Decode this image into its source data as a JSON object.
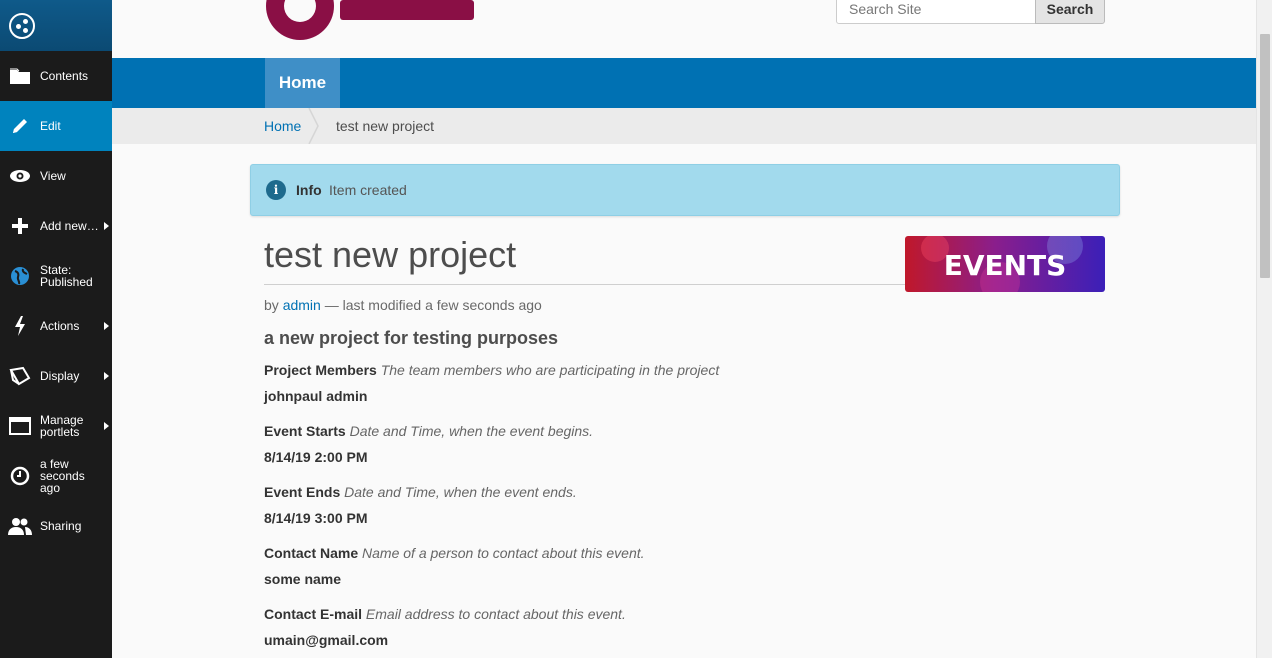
{
  "toolbar": {
    "items": [
      {
        "label": "Contents",
        "icon": "folder-icon"
      },
      {
        "label": "Edit",
        "icon": "pencil-icon"
      },
      {
        "label": "View",
        "icon": "eye-icon"
      },
      {
        "label": "Add new…",
        "icon": "plus-icon"
      },
      {
        "label": "State: Published",
        "icon": "globe-icon"
      },
      {
        "label": "Actions",
        "icon": "lightning-icon"
      },
      {
        "label": "Display",
        "icon": "display-icon"
      },
      {
        "label": "Manage portlets",
        "icon": "window-icon"
      },
      {
        "label": "a few seconds ago",
        "icon": "clock-icon"
      },
      {
        "label": "Sharing",
        "icon": "users-icon"
      }
    ]
  },
  "header": {
    "search_placeholder": "Search Site",
    "search_button": "Search"
  },
  "nav": {
    "home": "Home"
  },
  "breadcrumbs": {
    "home": "Home",
    "current": "test new project"
  },
  "message": {
    "title": "Info",
    "text": "Item created"
  },
  "document": {
    "title": "test new project",
    "byline_prefix": "by",
    "author": "admin",
    "modified": "— last modified a few seconds ago",
    "banner_text": "EVENTS",
    "description": "a new project for testing purposes"
  },
  "fields": [
    {
      "label": "Project Members",
      "help": "The team members who are participating in the project",
      "value": "johnpaul admin"
    },
    {
      "label": "Event Starts",
      "help": "Date and Time, when the event begins.",
      "value": "8/14/19 2:00 PM"
    },
    {
      "label": "Event Ends",
      "help": "Date and Time, when the event ends.",
      "value": "8/14/19 3:00 PM"
    },
    {
      "label": "Contact Name",
      "help": "Name of a person to contact about this event.",
      "value": "some name"
    },
    {
      "label": "Contact E-mail",
      "help": "Email address to contact about this event.",
      "value": "umain@gmail.com"
    }
  ],
  "colors": {
    "toolbar_bg": "#1b1b1b",
    "toolbar_active": "#0083be",
    "nav_bg": "#0071b3",
    "brand": "#8a0f45",
    "info_bg": "#a2daed"
  }
}
